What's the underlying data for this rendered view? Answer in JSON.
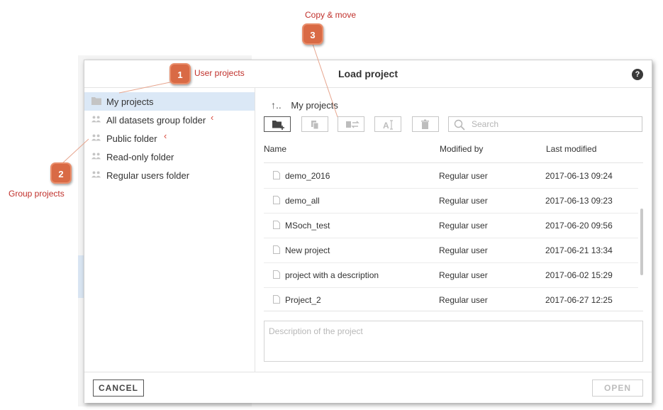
{
  "dialog": {
    "title": "Load project",
    "help_glyph": "?"
  },
  "sidebar": {
    "items": [
      {
        "label": "My projects",
        "icon": "folder-icon",
        "selected": true
      },
      {
        "label": "All datasets group folder",
        "icon": "group-icon",
        "selected": false
      },
      {
        "label": "Public folder",
        "icon": "group-icon",
        "selected": false
      },
      {
        "label": "Read-only folder",
        "icon": "group-icon",
        "selected": false
      },
      {
        "label": "Regular users folder",
        "icon": "group-icon",
        "selected": false
      }
    ]
  },
  "main": {
    "breadcrumb": {
      "up_glyph": "↑..",
      "current": "My projects"
    },
    "toolbar": {
      "buttons": [
        "new-folder-icon",
        "copy-icon",
        "move-icon",
        "rename-icon",
        "delete-icon"
      ]
    },
    "search": {
      "placeholder": "Search",
      "value": ""
    },
    "columns": {
      "name": "Name",
      "modified_by": "Modified by",
      "last_modified": "Last modified"
    },
    "rows": [
      {
        "name": "demo_2016",
        "modified_by": "Regular user",
        "last_modified": "2017-06-13 09:24"
      },
      {
        "name": "demo_all",
        "modified_by": "Regular user",
        "last_modified": "2017-06-13 09:23"
      },
      {
        "name": "MSoch_test",
        "modified_by": "Regular user",
        "last_modified": "2017-06-20 09:56"
      },
      {
        "name": "New project",
        "modified_by": "Regular user",
        "last_modified": "2017-06-21 13:34"
      },
      {
        "name": "project with a description",
        "modified_by": "Regular user",
        "last_modified": "2017-06-02 15:29"
      },
      {
        "name": "Project_2",
        "modified_by": "Regular user",
        "last_modified": "2017-06-27 12:25"
      }
    ],
    "description": {
      "placeholder": "Description of the project",
      "value": ""
    }
  },
  "footer": {
    "cancel_label": "CANCEL",
    "open_label": "OPEN"
  },
  "annotations": [
    {
      "number": "1",
      "label": "User projects"
    },
    {
      "number": "2",
      "label": "Group projects"
    },
    {
      "number": "3",
      "label": "Copy & move"
    }
  ],
  "colors": {
    "accent_callout": "#d96a45",
    "annotation_text": "#c0302b",
    "selected_row": "#dbe8f6"
  }
}
